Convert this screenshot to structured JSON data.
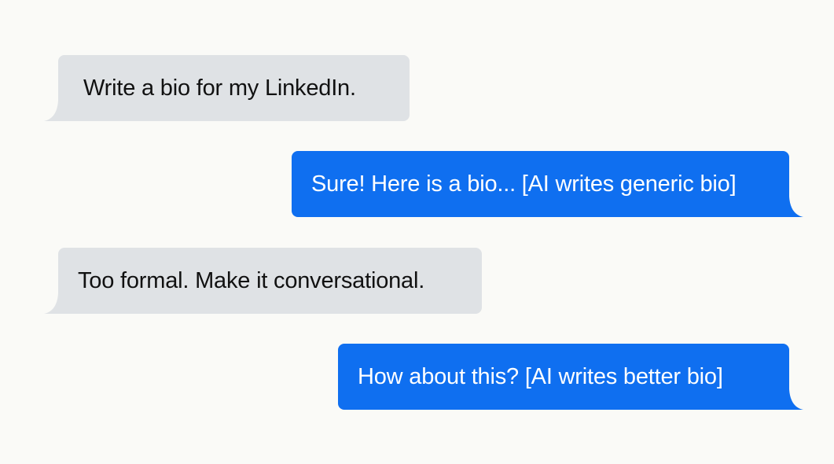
{
  "messages": [
    {
      "sender": "user",
      "text": "Write a bio for my LinkedIn."
    },
    {
      "sender": "assistant",
      "text": "Sure! Here is a bio... [AI writes generic bio]"
    },
    {
      "sender": "user",
      "text": "Too formal. Make it conversational."
    },
    {
      "sender": "assistant",
      "text": "How about this? [AI writes better bio]"
    }
  ],
  "colors": {
    "background": "#fafaf7",
    "received_bubble": "#dfe2e5",
    "sent_bubble": "#0f6ff0"
  }
}
